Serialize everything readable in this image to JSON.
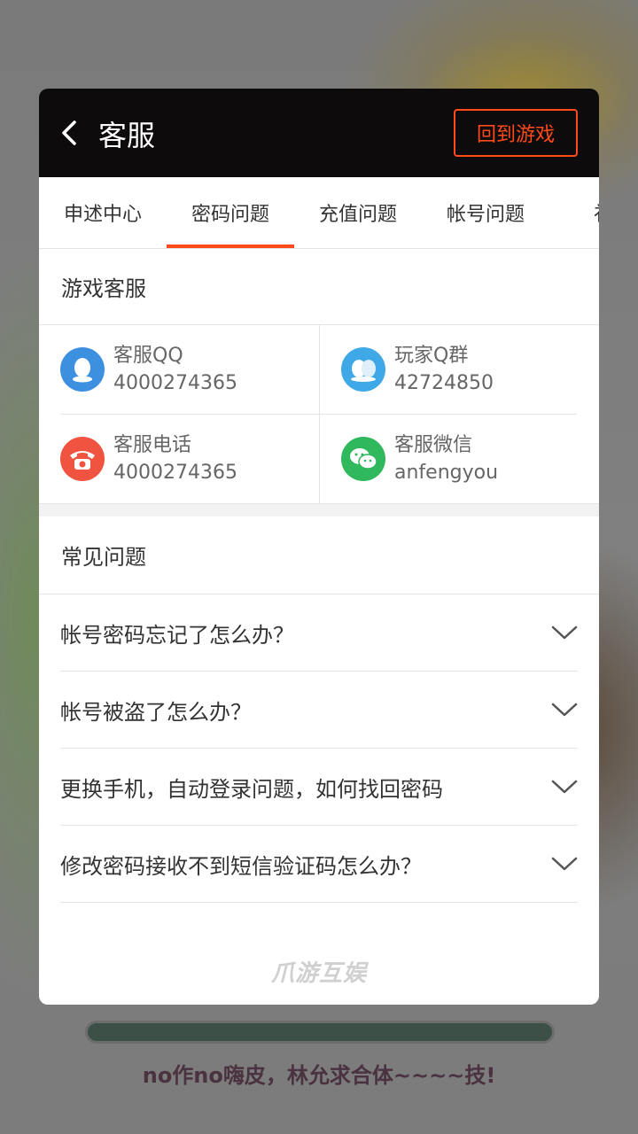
{
  "header": {
    "title": "客服",
    "return_label": "回到游戏"
  },
  "tabs": [
    {
      "label": "申述中心",
      "active": false
    },
    {
      "label": "密码问题",
      "active": true
    },
    {
      "label": "充值问题",
      "active": false
    },
    {
      "label": "帐号问题",
      "active": false
    },
    {
      "label": "礼包",
      "active": false
    }
  ],
  "service": {
    "title": "游戏客服",
    "contacts": [
      {
        "label": "客服QQ",
        "value": "4000274365",
        "icon": "qq-icon",
        "color": "#3d8fe0"
      },
      {
        "label": "玩家Q群",
        "value": "42724850",
        "icon": "qq-group-icon",
        "color": "#3fa8e6"
      },
      {
        "label": "客服电话",
        "value": "4000274365",
        "icon": "phone-icon",
        "color": "#f0533f"
      },
      {
        "label": "客服微信",
        "value": "anfengyou",
        "icon": "wechat-icon",
        "color": "#2fb85c"
      }
    ]
  },
  "faq": {
    "title": "常见问题",
    "items": [
      "帐号密码忘记了怎么办？",
      "帐号被盗了怎么办？",
      "更换手机，自动登录问题，如何找回密码",
      "修改密码接收不到短信验证码怎么办？"
    ]
  },
  "brand": "爪游互娱",
  "background": {
    "caption": "no作no嗨皮，林允求合体~~~~技!"
  },
  "colors": {
    "accent": "#ff4a1a",
    "header_bg": "#0d0b0b"
  }
}
